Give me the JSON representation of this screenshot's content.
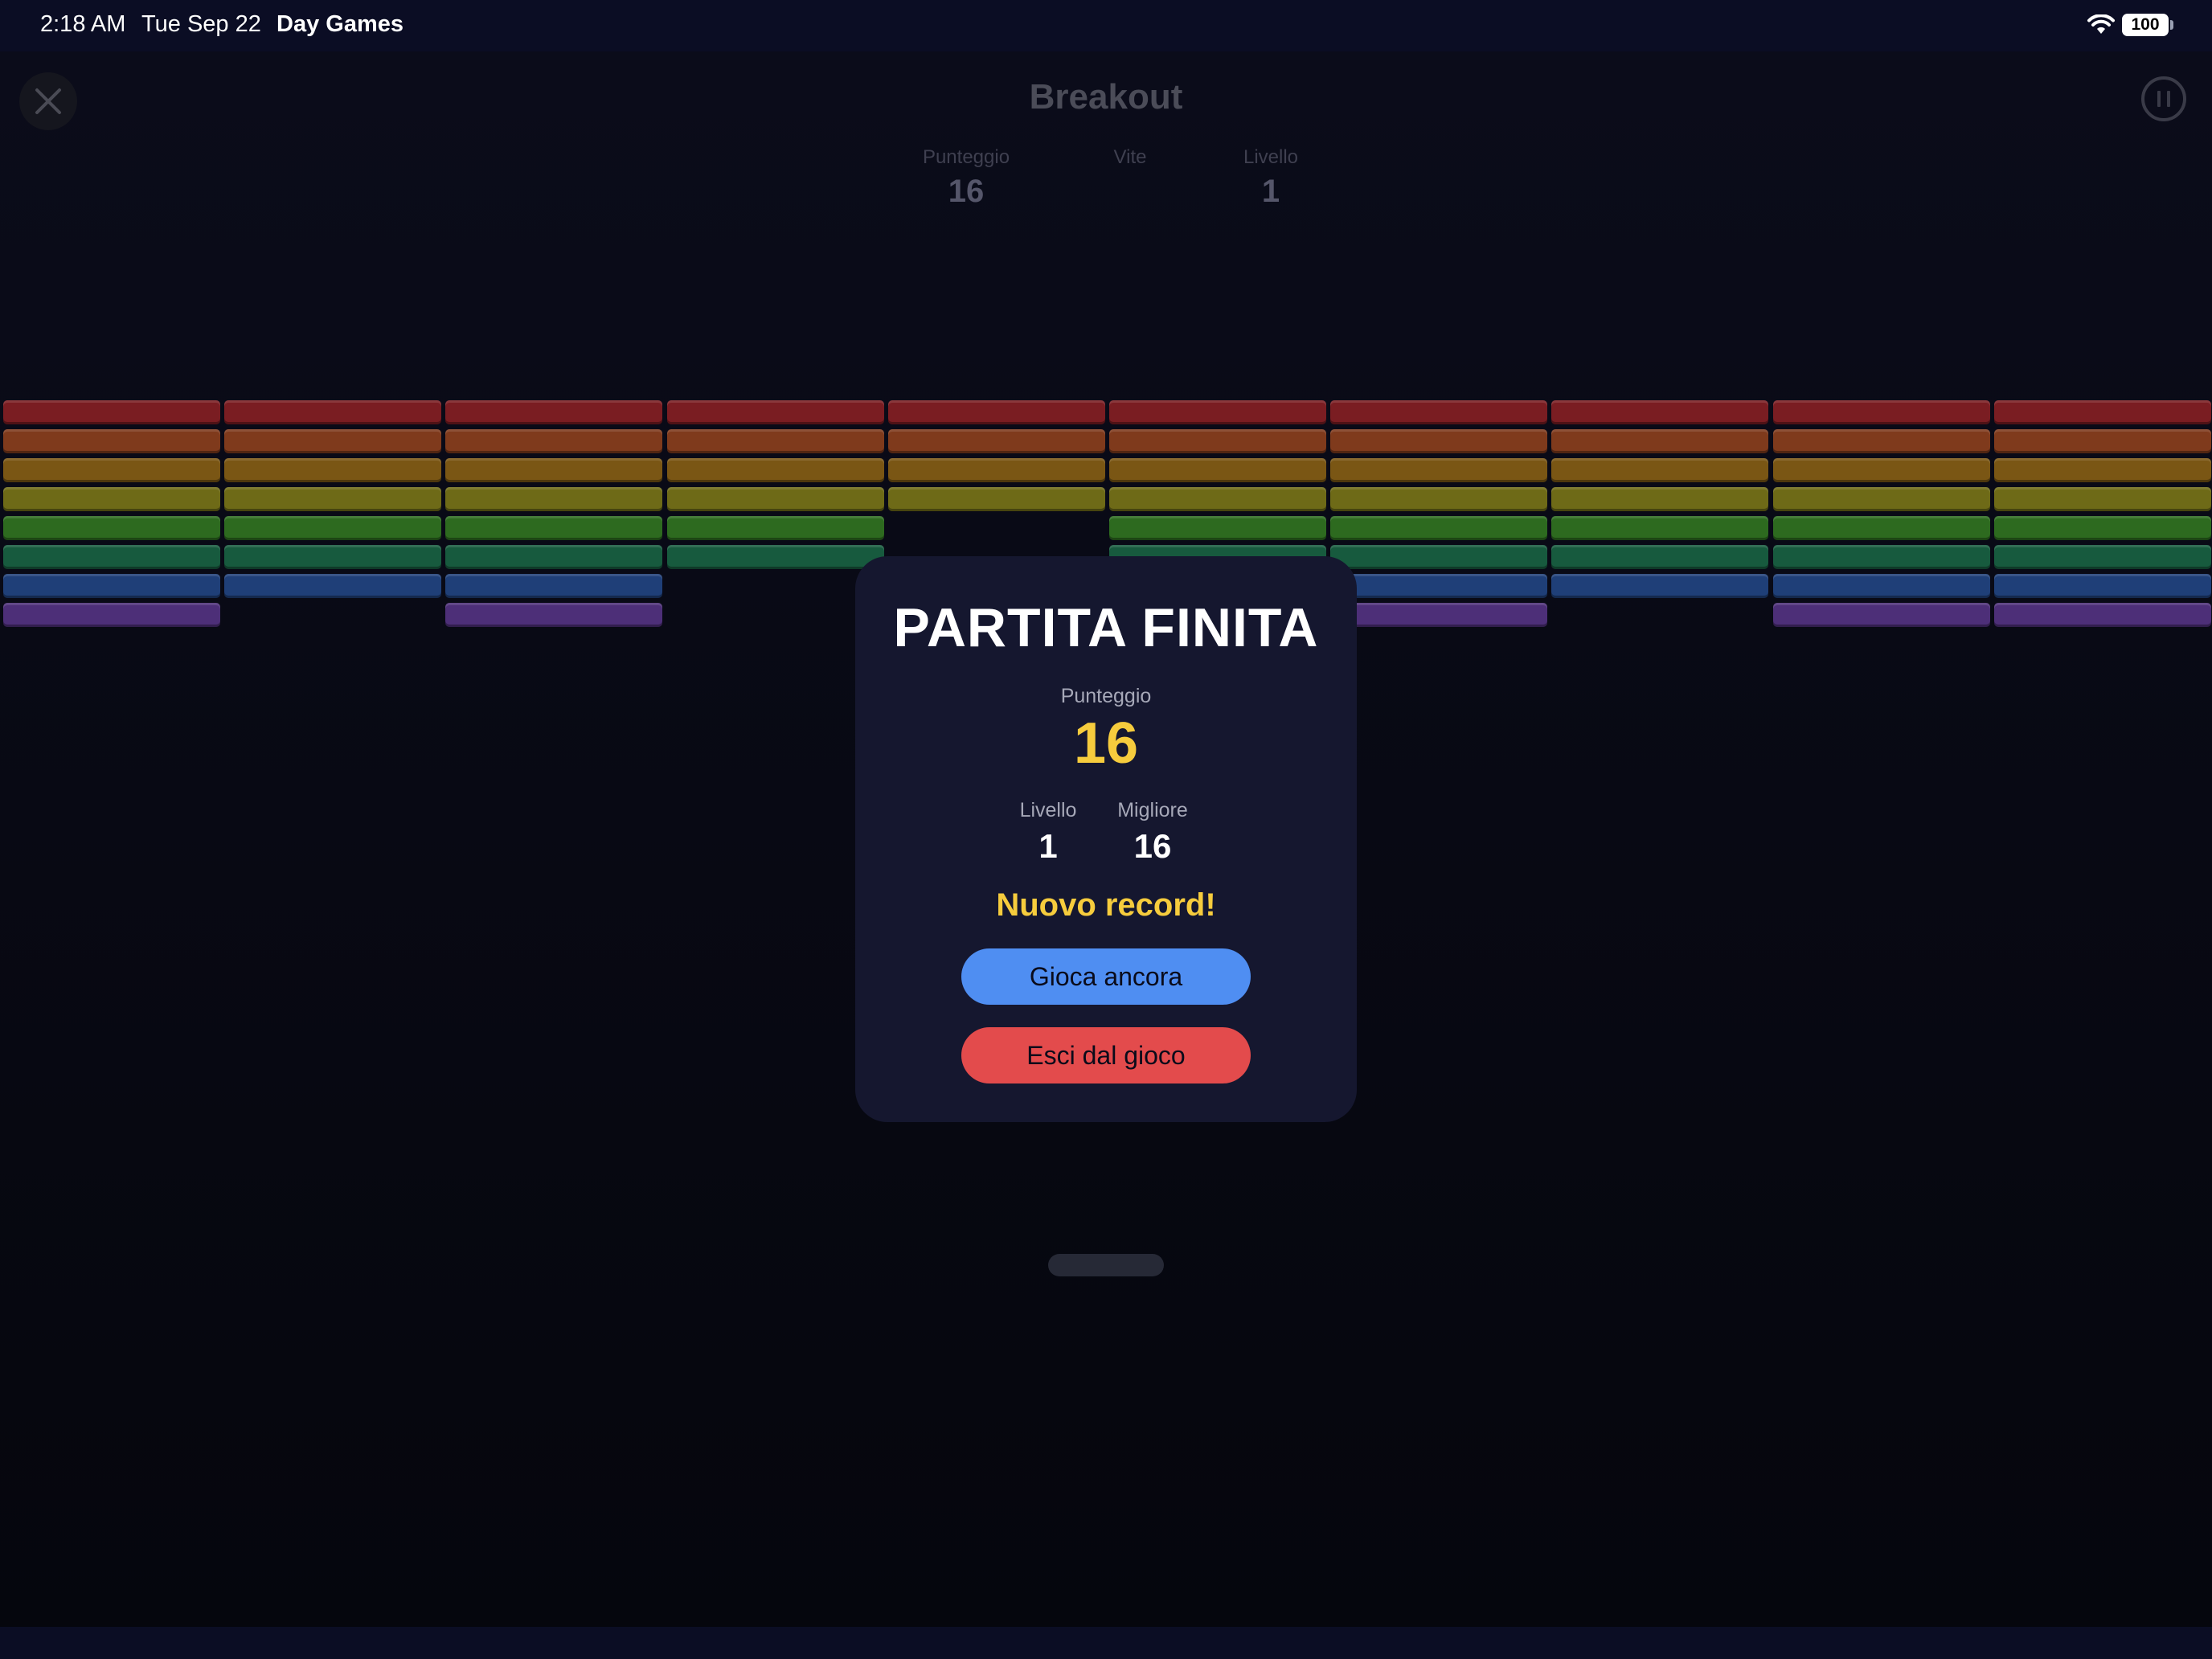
{
  "status_bar": {
    "time": "2:18 AM",
    "date": "Tue Sep 22",
    "app_name": "Day Games",
    "battery": "100"
  },
  "game": {
    "title": "Breakout",
    "stats": [
      {
        "label": "Punteggio",
        "value": "16"
      },
      {
        "label": "Vite",
        "value": ""
      },
      {
        "label": "Livello",
        "value": "1"
      }
    ],
    "brick_colors": [
      "#7a1d22",
      "#7f3a1c",
      "#7a5614",
      "#6e6a17",
      "#2d6a1f",
      "#175a3e",
      "#1f3f78",
      "#4d2f78"
    ],
    "brick_missing": [
      [],
      [],
      [],
      [],
      [
        4
      ],
      [
        4
      ],
      [
        3,
        4
      ],
      [
        1,
        3,
        4,
        7
      ]
    ]
  },
  "modal": {
    "title": "PARTITA FINITA",
    "score_label": "Punteggio",
    "score_value": "16",
    "level_label": "Livello",
    "level_value": "1",
    "best_label": "Migliore",
    "best_value": "16",
    "record_text": "Nuovo record!",
    "play_again_label": "Gioca ancora",
    "exit_label": "Esci dal gioco"
  },
  "colors": {
    "accent_yellow": "#f6cc3d",
    "play_button": "#4f8ef2",
    "exit_button": "#e34b4c",
    "modal_bg": "#15172f"
  }
}
